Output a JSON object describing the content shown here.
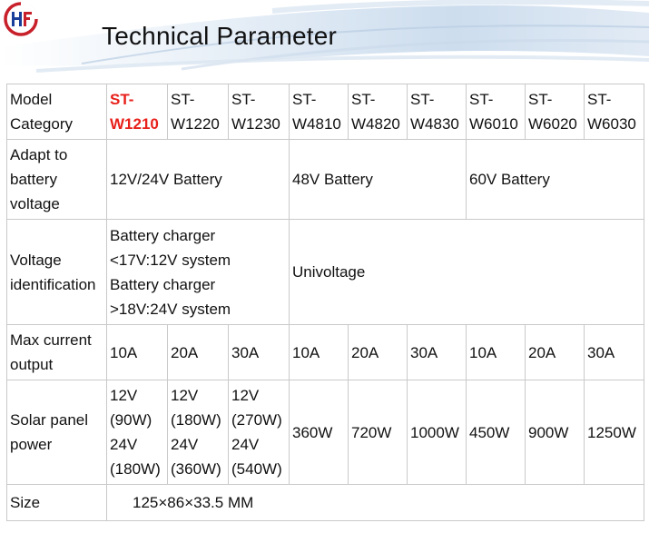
{
  "header": {
    "title": "Technical Parameter",
    "accent": "#d9e6f3"
  },
  "table": {
    "model_label": "Model Category",
    "models": [
      "ST-W1210",
      "ST-W1220",
      "ST-W1230",
      "ST-W4810",
      "ST-W4820",
      "ST-W4830",
      "ST-W6010",
      "ST-W6020",
      "ST-W6030"
    ],
    "highlight_color": "#e8201a",
    "battery_label": "Adapt to battery voltage",
    "battery_values": [
      "12V/24V Battery",
      "48V Battery",
      "60V Battery"
    ],
    "voltage_label": "Voltage identification",
    "voltage_left": [
      "Battery charger",
      "<17V:12V system",
      "Battery charger",
      ">18V:24V system"
    ],
    "voltage_right": "Univoltage",
    "current_label": "Max current output",
    "current_values": [
      "10A",
      "20A",
      "30A",
      "10A",
      "20A",
      "30A",
      "10A",
      "20A",
      "30A"
    ],
    "solar_label": "Solar panel power",
    "solar_stacked": [
      [
        "12V",
        "(90W)",
        "24V",
        "(180W)"
      ],
      [
        "12V",
        "(180W)",
        "24V",
        "(360W)"
      ],
      [
        "12V",
        "(270W)",
        "24V",
        "(540W)"
      ]
    ],
    "solar_values": [
      "360W",
      "720W",
      "1000W",
      "450W",
      "900W",
      "1250W"
    ],
    "size_label": "Size",
    "size_value": "125×86×33.5 MM"
  }
}
